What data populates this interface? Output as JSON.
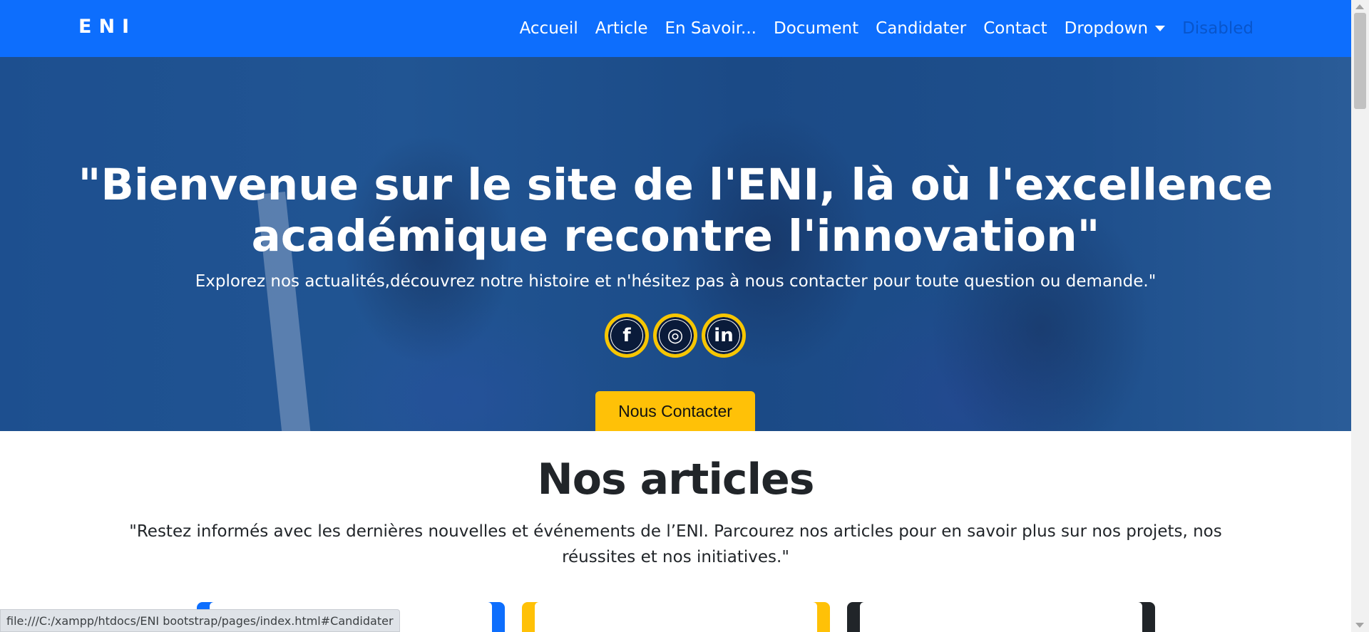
{
  "navbar": {
    "brand": "ENI",
    "links": [
      "Accueil",
      "Article",
      "En Savoir...",
      "Document",
      "Candidater",
      "Contact"
    ],
    "dropdown_label": "Dropdown",
    "disabled_label": "Disabled",
    "background_color": "#0d6efd"
  },
  "hero": {
    "title_line1": "\"Bienvenue sur le site de l'ENI, là où l'excellence",
    "title_line2": "académique recontre l'innovation\"",
    "subtitle": "Explorez nos actualités,découvrez notre histoire et n'hésitez pas à nous contacter pour toute question ou demande.\"",
    "socials": [
      {
        "icon": "facebook-icon",
        "glyph": "f"
      },
      {
        "icon": "instagram-icon",
        "glyph": "◎"
      },
      {
        "icon": "linkedin-icon",
        "glyph": "in"
      }
    ],
    "cta_label": "Nous Contacter",
    "cta_color": "#ffc107",
    "social_ring_color": "#f7c600"
  },
  "articles": {
    "title": "Nos articles",
    "description": "\"Restez informés avec les dernières nouvelles et événements de l’ENI. Parcourez nos articles pour en savoir plus sur nos projets, nos réussites et nos initiatives.\"",
    "card_colors": [
      "#0d6efd",
      "#ffc107",
      "#212529"
    ]
  },
  "status_bar": {
    "url": "file:///C:/xampp/htdocs/ENI bootstrap/pages/index.html#Candidater"
  }
}
